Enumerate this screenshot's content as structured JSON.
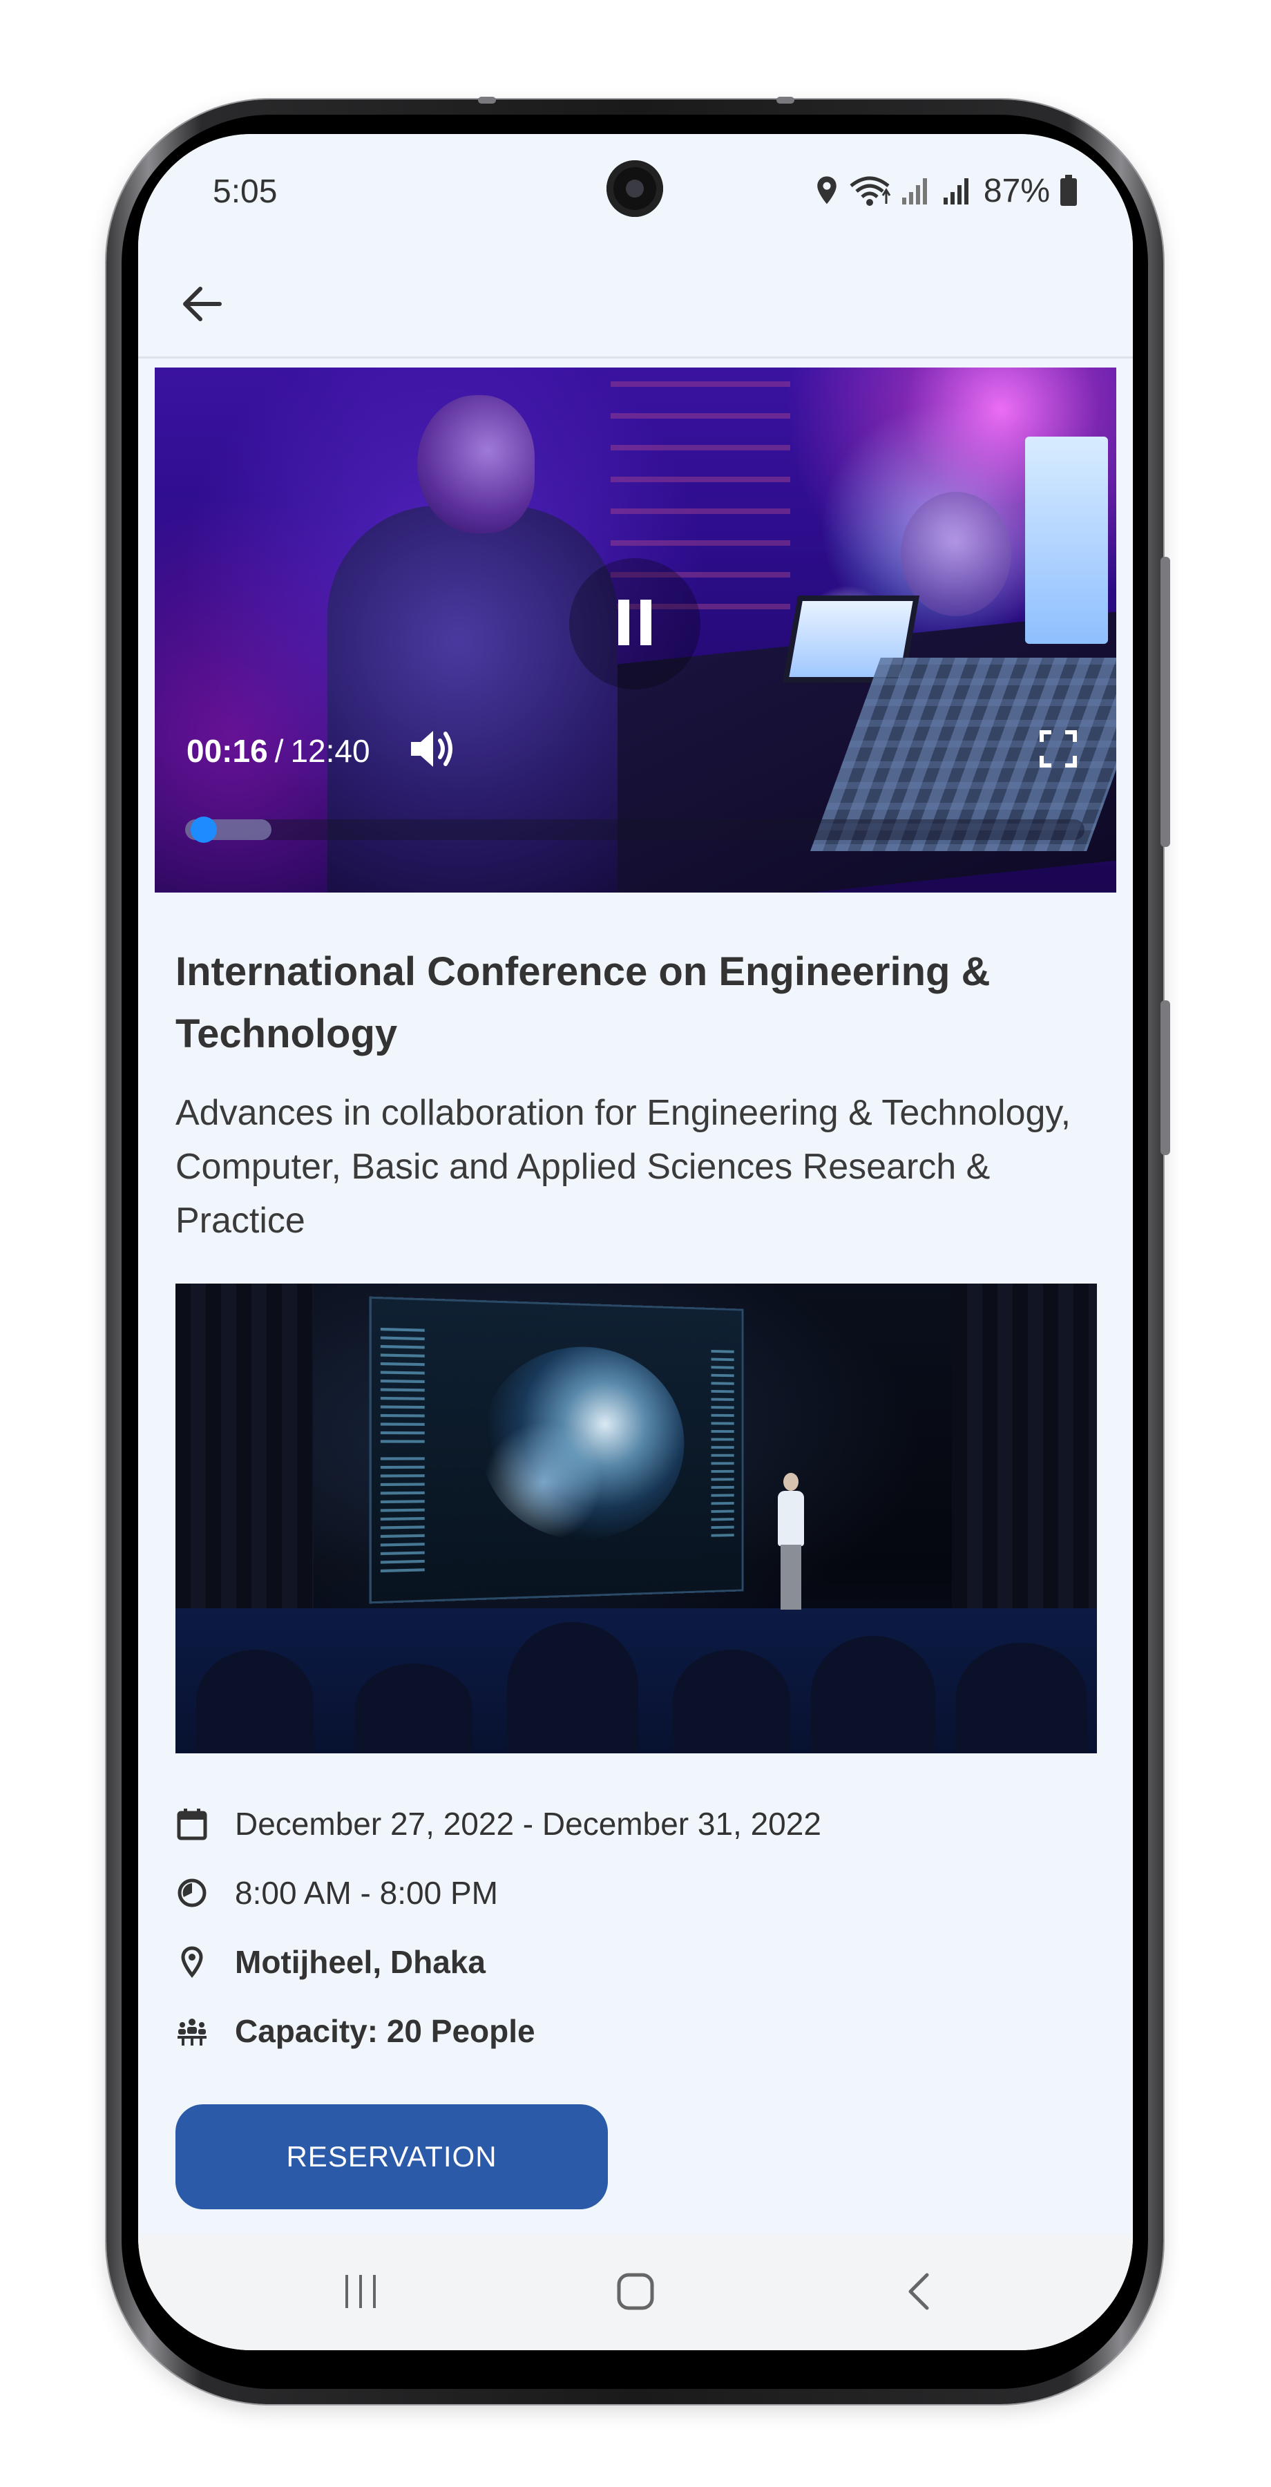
{
  "status_bar": {
    "time": "5:05",
    "battery": "87%",
    "icons": [
      "location-icon",
      "wifi-icon",
      "signal-icon",
      "signal-icon",
      "battery-icon"
    ]
  },
  "app_bar": {
    "back_icon": "arrow-left-icon"
  },
  "video": {
    "current_time": "00:16",
    "separator": "/",
    "total_time": "12:40",
    "progress_fraction": 0.021,
    "buffer_fraction": 0.096,
    "state_icon": "pause-icon",
    "volume_icon": "volume-icon",
    "fullscreen_icon": "fullscreen-icon"
  },
  "event": {
    "title": "International Conference on Engineering & Technology",
    "subtitle": "Advances in collaboration for Engineering & Technology, Computer, Basic and Applied Sciences Research & Practice",
    "photo_icon": "conference-stage-photo",
    "date_range": "December 27, 2022 - December 31, 2022",
    "time_range": "8:00 AM - 8:00 PM",
    "location": "Motijheel, Dhaka",
    "capacity": "Capacity: 20 People",
    "icons": {
      "date": "calendar-icon",
      "time": "clock-icon",
      "location": "map-pin-icon",
      "capacity": "group-icon"
    }
  },
  "actions": {
    "reservation_label": "RESERVATION"
  },
  "colors": {
    "screen_bg": "#f1f6fc",
    "text_primary": "#333333",
    "button_bg": "#2b5aa8",
    "button_text": "#ffffff",
    "progress_thumb": "#1e8cff"
  }
}
